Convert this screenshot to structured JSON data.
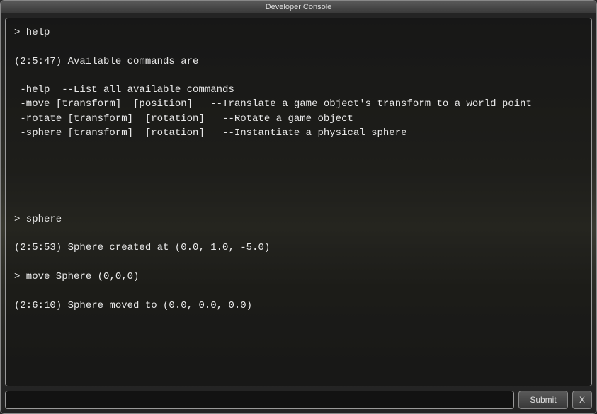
{
  "window": {
    "title": "Developer Console"
  },
  "console": {
    "output": "> help\n\n(2:5:47) Available commands are\n\n -help  --List all available commands\n -move [transform]  [position]   --Translate a game object's transform to a world point\n -rotate [transform]  [rotation]   --Rotate a game object\n -sphere [transform]  [rotation]   --Instantiate a physical sphere\n\n\n\n\n\n> sphere\n\n(2:5:53) Sphere created at (0.0, 1.0, -5.0)\n\n> move Sphere (0,0,0)\n\n(2:6:10) Sphere moved to (0.0, 0.0, 0.0)"
  },
  "input": {
    "value": "",
    "placeholder": ""
  },
  "buttons": {
    "submit": "Submit",
    "close": "X"
  }
}
